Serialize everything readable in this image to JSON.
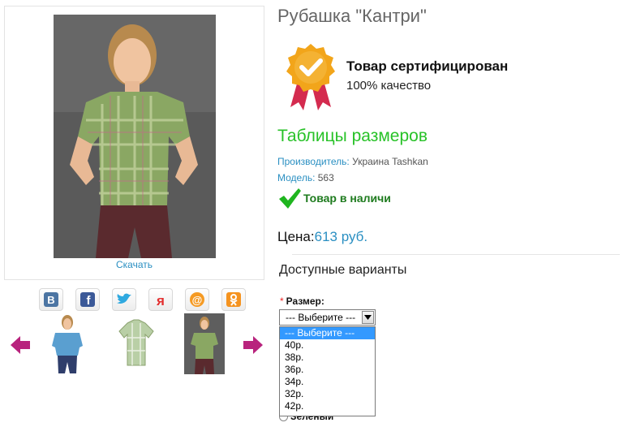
{
  "product": {
    "title": "Рубашка \"Кантри\"",
    "download_label": "Скачать",
    "certified_title": "Товар сертифицирован",
    "certified_sub": "100% качество",
    "size_tables_link": "Таблицы размеров",
    "manufacturer_label": "Производитель:",
    "manufacturer_value": "Украина Tashkan",
    "model_label": "Модель:",
    "model_value": "563",
    "stock_status": "Товар в наличи",
    "price_label": "Цена:",
    "price_value": "613 руб."
  },
  "social": [
    "vk-icon",
    "facebook-icon",
    "twitter-icon",
    "yandex-icon",
    "mail-icon",
    "odnoklassniki-icon"
  ],
  "options": {
    "heading": "Доступные варианты",
    "required_mark": "*",
    "size_label": "Размер:",
    "size_selected": "--- Выберите ---",
    "size_list": [
      "--- Выберите ---",
      "40р.",
      "38р.",
      "36р.",
      "34р.",
      "32р.",
      "42р."
    ],
    "color_option_partial": "Зеленый"
  },
  "colors": {
    "link_blue": "#2a8fc2",
    "green_link": "#28c228",
    "stock_green": "#1e7b1e",
    "badge_gold": "#f2a51a",
    "ribbon_red": "#d42b4f",
    "arrow_purple": "#b8237d",
    "select_highlight": "#3399ff"
  }
}
